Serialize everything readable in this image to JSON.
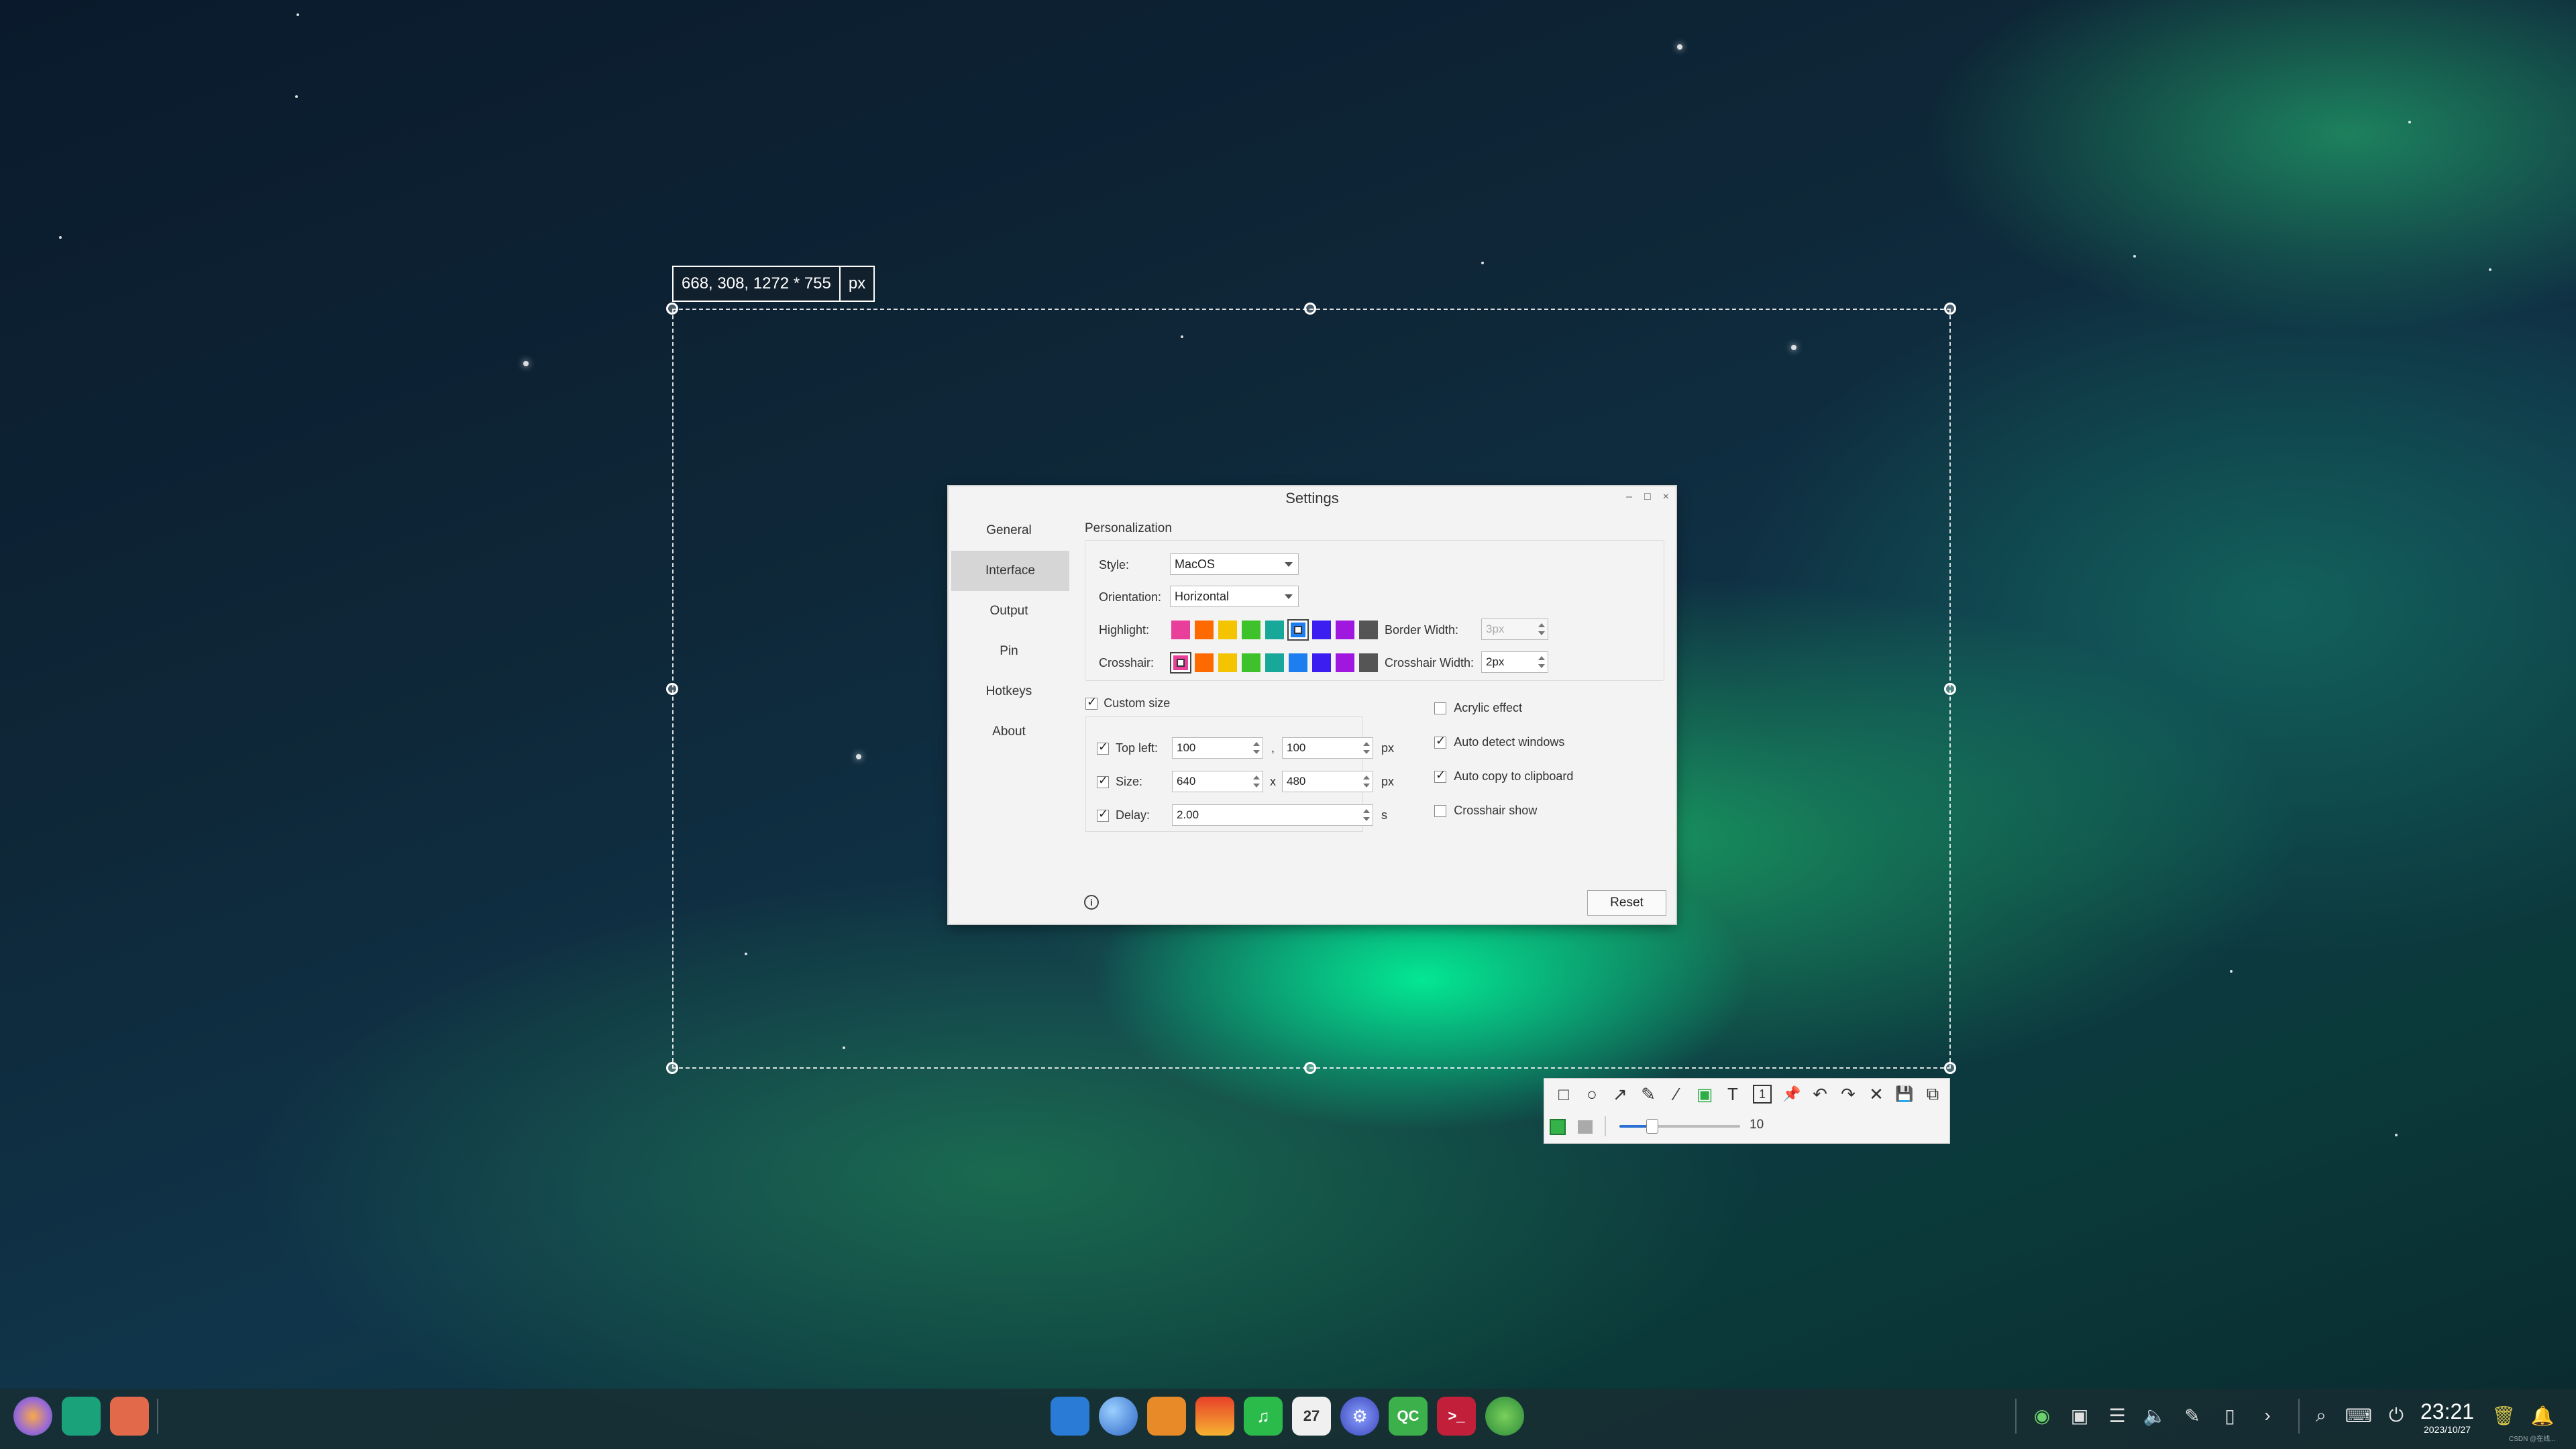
{
  "selection": {
    "coords_text": "668, 308, 1272 * 755",
    "unit": "px"
  },
  "settings": {
    "title": "Settings",
    "window_controls": [
      "–",
      "□",
      "×"
    ],
    "sidebar": [
      {
        "label": "General"
      },
      {
        "label": "Interface",
        "active": true
      },
      {
        "label": "Output"
      },
      {
        "label": "Pin"
      },
      {
        "label": "Hotkeys"
      },
      {
        "label": "About"
      }
    ],
    "personalization": {
      "section_title": "Personalization",
      "style_label": "Style:",
      "style_value": "MacOS",
      "orientation_label": "Orientation:",
      "orientation_value": "Horizontal",
      "highlight_label": "Highlight:",
      "crosshair_label": "Crosshair:",
      "border_width_label": "Border Width:",
      "border_width_value": "3px",
      "crosshair_width_label": "Crosshair Width:",
      "crosshair_width_value": "2px",
      "colors": [
        "#e8409a",
        "#ff6a00",
        "#f5c400",
        "#3dc22b",
        "#18a89a",
        "#1e7ef0",
        "#3c1ef0",
        "#a018e0",
        "#555555"
      ],
      "highlight_selected_index": 5,
      "crosshair_selected_index": 0
    },
    "custom_size": {
      "label": "Custom size",
      "checked": true,
      "top_left_label": "Top left:",
      "top_left_x": "100",
      "top_left_y": "100",
      "comma": ",",
      "size_label": "Size:",
      "size_w": "640",
      "size_h": "480",
      "x_sep": "x",
      "delay_label": "Delay:",
      "delay_value": "2.00",
      "unit_px": "px",
      "unit_s": "s"
    },
    "options": [
      {
        "label": "Acrylic effect",
        "checked": false
      },
      {
        "label": "Auto detect windows",
        "checked": true
      },
      {
        "label": "Auto copy to clipboard",
        "checked": true
      },
      {
        "label": "Crosshair show",
        "checked": false
      }
    ],
    "reset_label": "Reset",
    "info_glyph": "i"
  },
  "toolbar": {
    "tools": [
      {
        "name": "rectangle",
        "glyph": "□"
      },
      {
        "name": "ellipse",
        "glyph": "○"
      },
      {
        "name": "arrow",
        "glyph": "↗"
      },
      {
        "name": "pencil",
        "glyph": "✎"
      },
      {
        "name": "marker",
        "glyph": "⁄"
      },
      {
        "name": "mosaic",
        "glyph": "▣"
      },
      {
        "name": "text",
        "glyph": "T"
      },
      {
        "name": "counter",
        "glyph": "1"
      },
      {
        "name": "pin",
        "glyph": "📌"
      },
      {
        "name": "undo",
        "glyph": "↶"
      },
      {
        "name": "redo",
        "glyph": "↷"
      },
      {
        "name": "close",
        "glyph": "✕"
      },
      {
        "name": "save",
        "glyph": "💾"
      },
      {
        "name": "copy",
        "glyph": "⧉"
      }
    ],
    "slider_value": "10",
    "slider_fraction": 0.27
  },
  "taskbar": {
    "clock_time": "23:21",
    "clock_date": "2023/10/27",
    "calendar_day": "27",
    "qt_label": "QC",
    "corner_text": "CSDN @在线..."
  }
}
